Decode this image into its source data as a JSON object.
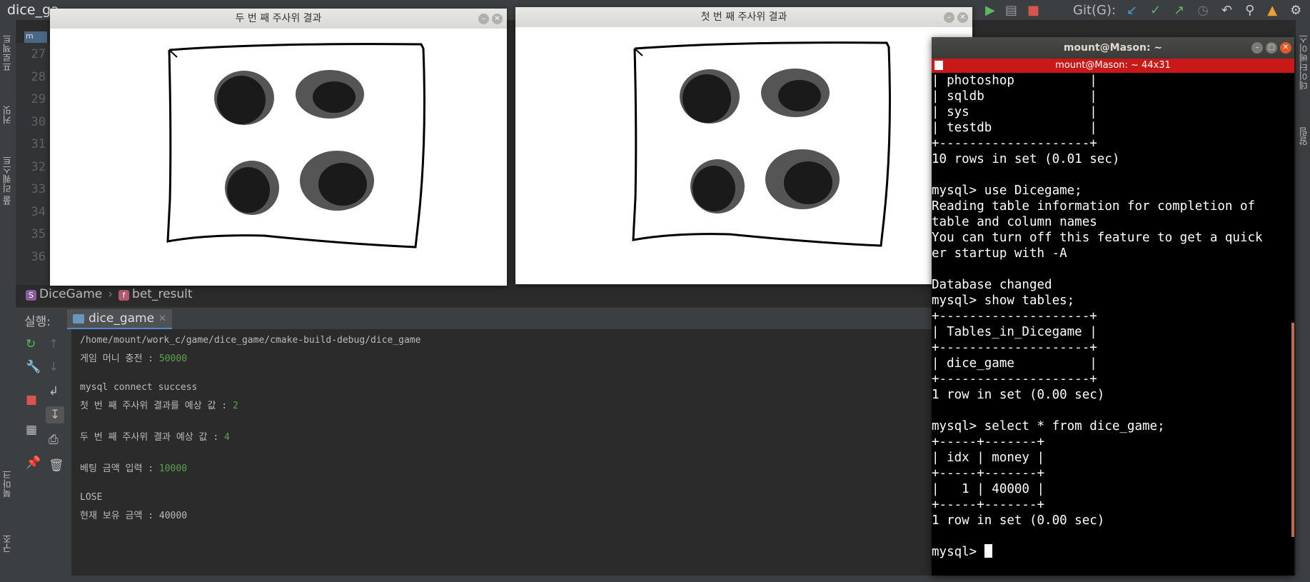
{
  "ide": {
    "project_name": "dice_ga",
    "git_label": "Git(G):",
    "left_panels": [
      "프로젝트",
      "커밋",
      "풀 리퀘스트"
    ],
    "left_panels_bottom": [
      "북마크",
      "구조"
    ],
    "right_panels": [
      "데이터베이스",
      "알림"
    ],
    "line_numbers": [
      "27",
      "28",
      "29",
      "30",
      "31",
      "32",
      "33",
      "34",
      "35",
      "36"
    ],
    "file_tab_badge": "m",
    "breadcrumb": {
      "struct_badge": "S",
      "struct": "DiceGame",
      "func_badge": "f",
      "func": "bet_result"
    },
    "run": {
      "title": "실행:",
      "tab_label": "dice_game",
      "console": [
        {
          "text": "/home/mount/work_c/game/dice_game/cmake-build-debug/dice_game",
          "input": ""
        },
        {
          "text": "게임 머니 충전 : ",
          "input": "50000"
        },
        {
          "text": "",
          "input": ""
        },
        {
          "text": "mysql connect success",
          "input": ""
        },
        {
          "text": "첫 번 째 주사위 결과를 예상 값 : ",
          "input": "2"
        },
        {
          "text": "",
          "input": ""
        },
        {
          "text": "두 번 째 주사위 결과 예상 값 : ",
          "input": "4"
        },
        {
          "text": "",
          "input": ""
        },
        {
          "text": "베팅 금액 입력 : ",
          "input": "10000"
        },
        {
          "text": "",
          "input": ""
        },
        {
          "text": "LOSE",
          "input": ""
        },
        {
          "text": "현재 보유 금액 : 40000",
          "input": ""
        }
      ]
    }
  },
  "image_windows": {
    "second": {
      "title": "두 번 째 주사위 결과",
      "dice_value": 4
    },
    "first": {
      "title": "첫 번 째 주사위 결과",
      "dice_value": 4
    }
  },
  "terminal": {
    "window_title": "mount@Mason: ~",
    "tab_title": "mount@Mason: ~ 44x31",
    "lines": [
      "| photoshop          |",
      "| sqldb              |",
      "| sys                |",
      "| testdb             |",
      "+--------------------+",
      "10 rows in set (0.01 sec)",
      "",
      "mysql> use Dicegame;",
      "Reading table information for completion of",
      "table and column names",
      "You can turn off this feature to get a quick",
      "er startup with -A",
      "",
      "Database changed",
      "mysql> show tables;",
      "+--------------------+",
      "| Tables_in_Dicegame |",
      "+--------------------+",
      "| dice_game          |",
      "+--------------------+",
      "1 row in set (0.00 sec)",
      "",
      "mysql> select * from dice_game;",
      "+-----+-------+",
      "| idx | money |",
      "+-----+-------+",
      "|   1 | 40000 |",
      "+-----+-------+",
      "1 row in set (0.00 sec)",
      ""
    ],
    "prompt": "mysql> "
  },
  "colors": {
    "terminal_tab_red": "#c91818",
    "console_input_green": "#5ca24e",
    "ide_dark": "#2b2b2b"
  }
}
